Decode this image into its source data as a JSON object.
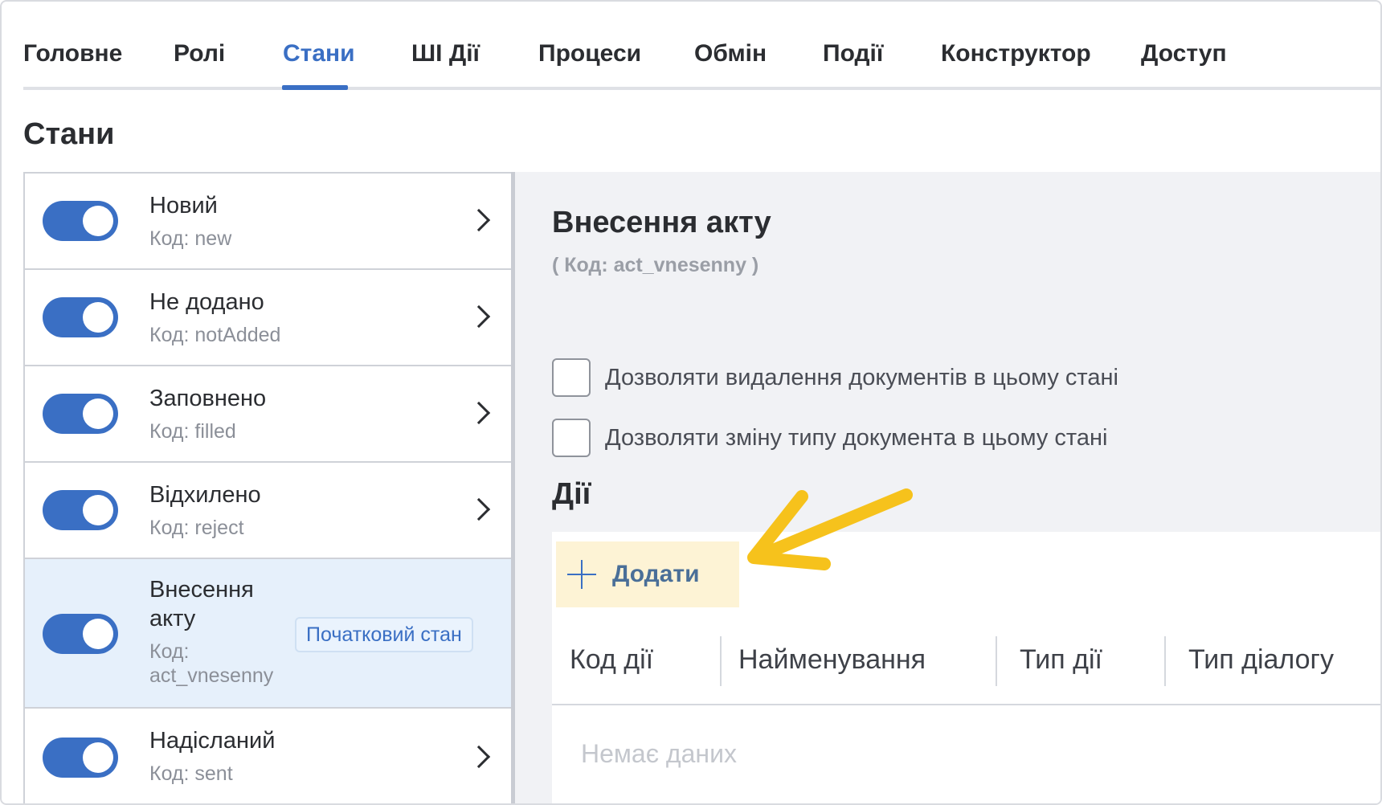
{
  "tabs": [
    {
      "label": "Головне",
      "active": false
    },
    {
      "label": "Ролі",
      "active": false
    },
    {
      "label": "Стани",
      "active": true
    },
    {
      "label": "ШІ Дії",
      "active": false
    },
    {
      "label": "Процеси",
      "active": false
    },
    {
      "label": "Обмін",
      "active": false
    },
    {
      "label": "Події",
      "active": false
    },
    {
      "label": "Конструктор",
      "active": false
    },
    {
      "label": "Доступ",
      "active": false
    }
  ],
  "page_title": "Стани",
  "states": [
    {
      "name": "Новий",
      "code": "Код: new",
      "enabled": true
    },
    {
      "name": "Не додано",
      "code": "Код: notAdded",
      "enabled": true
    },
    {
      "name": "Заповнено",
      "code": "Код: filled",
      "enabled": true
    },
    {
      "name": "Відхилено",
      "code": "Код: reject",
      "enabled": true
    },
    {
      "name_line1": "Внесення",
      "name_line2": "акту",
      "code_line1": "Код:",
      "code_line2": "act_vnesenny",
      "badge": "Початковий стан",
      "enabled": true,
      "selected": true
    },
    {
      "name": "Надісланий",
      "code": "Код: sent",
      "enabled": true
    }
  ],
  "detail": {
    "title": "Внесення акту",
    "code": "( Код: act_vnesenny )",
    "checkboxes": [
      {
        "label": "Дозволяти видалення документів в цьому стані",
        "checked": false
      },
      {
        "label": "Дозволяти зміну типу документа в цьому стані",
        "checked": false
      }
    ],
    "actions_title": "Дії",
    "add_label": "Додати",
    "columns": [
      "Код дії",
      "Найменування",
      "Тип дії",
      "Тип діалогу"
    ],
    "empty_text": "Немає даних"
  },
  "colors": {
    "accent": "#3a6fc4",
    "highlight": "#fdf3d5",
    "arrow": "#f6c21c"
  }
}
